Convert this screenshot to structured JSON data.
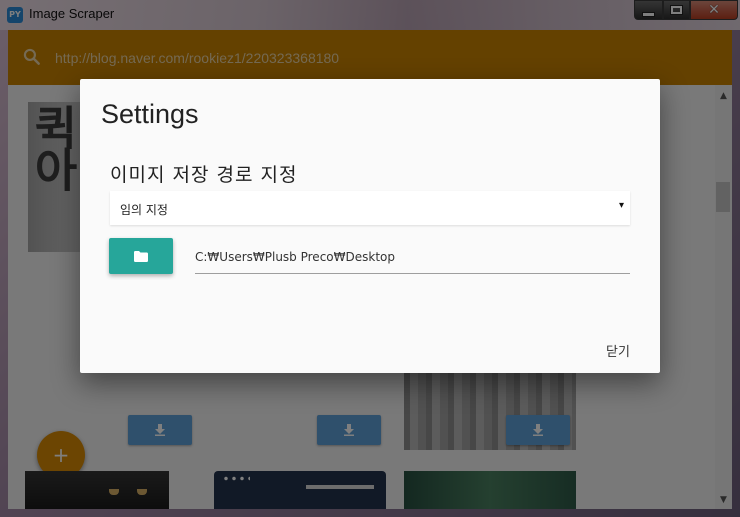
{
  "window": {
    "title": "Image Scraper",
    "app_icon_text": "PY",
    "controls": {
      "minimize": "minimize-icon",
      "maximize": "maximize-icon",
      "close": "close-icon",
      "close_glyph": "✕"
    }
  },
  "search": {
    "url": "http://blog.naver.com/rookiez1/220323368180",
    "icon": "search-icon"
  },
  "background": {
    "image_text": "퀵아",
    "fab_label": "+",
    "download_icon": "download-icon",
    "scroll_up": "▲",
    "scroll_down": "▼"
  },
  "dialog": {
    "title": "Settings",
    "section_heading": "이미지 저장 경로 지정",
    "select_value": "임의 지정",
    "select_arrow": "▾",
    "folder_icon": "folder-icon",
    "path_value": "C:₩Users₩Plusb Preco₩Desktop",
    "close_label": "닫기"
  },
  "colors": {
    "search_bar": "#c88200",
    "folder_button": "#26a69a",
    "download_button": "#5fa0d8",
    "fab": "#d98a05"
  }
}
